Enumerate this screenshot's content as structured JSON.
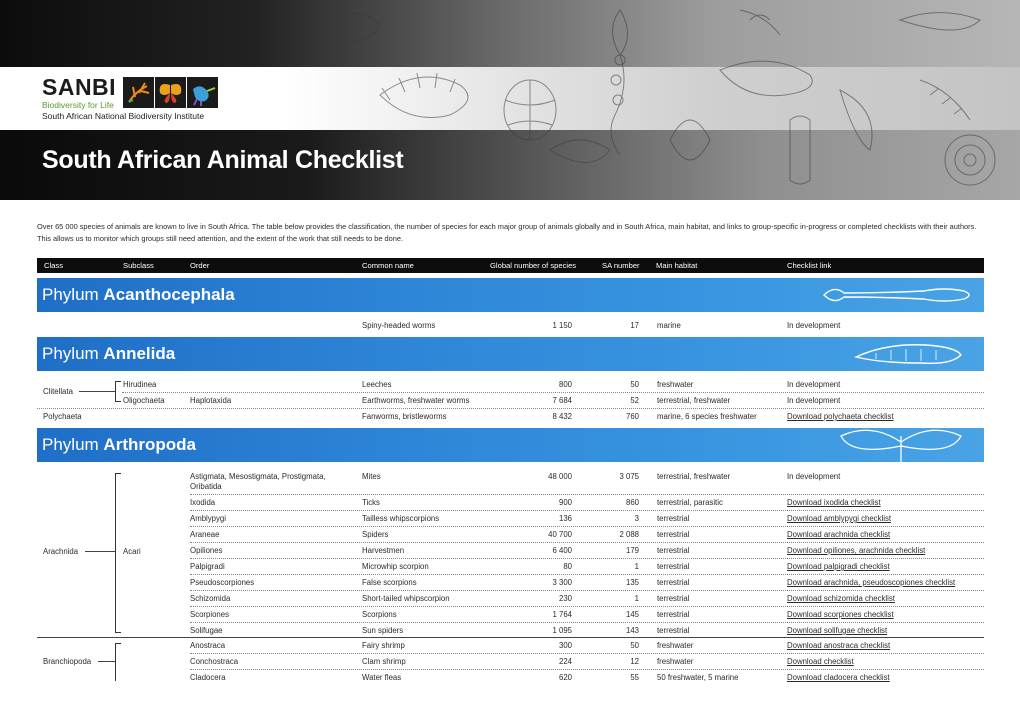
{
  "header": {
    "logo_word": "SANBI",
    "logo_tagline": "Biodiversity for Life",
    "logo_institute": "South African National Biodiversity Institute",
    "title": "South African Animal Checklist"
  },
  "intro": "Over 65 000 species of animals are known to live in South Africa. The table below provides the classification, the number of species for each major group of animals globally and in South Africa, main habitat, and links to group-specific in-progress or completed checklists with their authors. This allows us to monitor which groups still need attention, and the extent of the work that still needs to be done.",
  "columns": [
    "Class",
    "Subclass",
    "Order",
    "Common name",
    "Global number of species",
    "SA number",
    "Main habitat",
    "Checklist link"
  ],
  "phyla": [
    {
      "prefix": "Phylum",
      "name": "Acanthocephala"
    },
    {
      "prefix": "Phylum",
      "name": "Annelida"
    },
    {
      "prefix": "Phylum",
      "name": "Arthropoda"
    }
  ],
  "groups": {
    "clitellata": "Clitellata",
    "polychaeta": "Polychaeta",
    "arachnida": "Arachnida",
    "acari": "Acari",
    "branchiopoda": "Branchiopoda"
  },
  "rows": [
    {
      "order": "",
      "common": "Spiny-headed worms",
      "global": "1 150",
      "sa": "17",
      "habitat": "marine",
      "link": "In development",
      "linked": false
    },
    {
      "order": "Hirudinea",
      "common": "Leeches",
      "global": "800",
      "sa": "50",
      "habitat": "freshwater",
      "link": "In development",
      "linked": false
    },
    {
      "order": "Oligochaeta",
      "order2": "Haplotaxida",
      "common": "Earthworms, freshwater worms",
      "global": "7 684",
      "sa": "52",
      "habitat": "terrestrial, freshwater",
      "link": "In development",
      "linked": false
    },
    {
      "order": "",
      "common": "Fanworms, bristleworms",
      "global": "8 432",
      "sa": "760",
      "habitat": "marine, 6 species freshwater",
      "link": "Download polychaeta checklist",
      "linked": true
    },
    {
      "order": "Astigmata, Mesostigmata, Prostigmata,",
      "order_line2": "Oribatida",
      "common": "Mites",
      "global": "48 000",
      "sa": "3 075",
      "habitat": "terrestrial, freshwater",
      "link": "In development",
      "linked": false
    },
    {
      "order": "Ixodida",
      "common": "Ticks",
      "global": "900",
      "sa": "860",
      "habitat": "terrestrial, parasitic",
      "link": "Download ixodida checklist",
      "linked": true
    },
    {
      "order": "Amblypygi",
      "common": "Tailless whipscorpions",
      "global": "136",
      "sa": "3",
      "habitat": "terrestrial",
      "link": "Download amblypygi checklist",
      "linked": true
    },
    {
      "order": "Araneae",
      "common": "Spiders",
      "global": "40 700",
      "sa": "2 088",
      "habitat": "terrestrial",
      "link": "Download arachnida checklist",
      "linked": true
    },
    {
      "order": "Opiliones",
      "common": "Harvestmen",
      "global": "6 400",
      "sa": "179",
      "habitat": "terrestrial",
      "link": "Download opiliones, arachnida checklist",
      "linked": true
    },
    {
      "order": "Palpigradi",
      "common": "Microwhip scorpion",
      "global": "80",
      "sa": "1",
      "habitat": "terrestrial",
      "link": "Download palpigradi checklist",
      "linked": true
    },
    {
      "order": "Pseudoscorpiones",
      "common": "False scorpions",
      "global": "3 300",
      "sa": "135",
      "habitat": "terrestrial",
      "link": "Download arachnida, pseudoscopiones checklist",
      "linked": true
    },
    {
      "order": "Schizomida",
      "common": "Short-tailed whipscorpion",
      "global": "230",
      "sa": "1",
      "habitat": "terrestrial",
      "link": "Download schizomida checklist",
      "linked": true
    },
    {
      "order": "Scorpiones",
      "common": "Scorpions",
      "global": "1 764",
      "sa": "145",
      "habitat": "terrestrial",
      "link": "Download scorpiones checklist",
      "linked": true
    },
    {
      "order": "Solifugae",
      "common": "Sun spiders",
      "global": "1 095",
      "sa": "143",
      "habitat": "terrestrial",
      "link": "Download solifugae checklist",
      "linked": true
    },
    {
      "order": "Anostraca",
      "common": "Fairy shrimp",
      "global": "300",
      "sa": "50",
      "habitat": "freshwater",
      "link": "Download anostraca checklist",
      "linked": true
    },
    {
      "order": "Conchostraca",
      "common": "Clam shrimp",
      "global": "224",
      "sa": "12",
      "habitat": "freshwater",
      "link": "Download checklist",
      "linked": true
    },
    {
      "order": "Cladocera",
      "common": "Water fleas",
      "global": "620",
      "sa": "55",
      "habitat": "50 freshwater, 5 marine",
      "link": "Download cladocera checklist",
      "linked": true
    }
  ],
  "colors": {
    "phylum_band": "#2e86d8",
    "header_bar": "#0d0d0d",
    "logo_green": "#5b9b2a"
  }
}
